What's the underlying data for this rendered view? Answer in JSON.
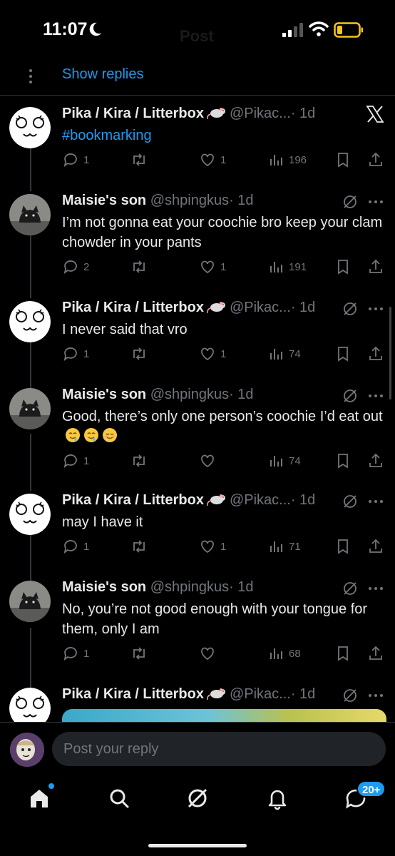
{
  "status_bar": {
    "time": "11:07"
  },
  "header": {
    "title_faint": "Post"
  },
  "show_replies": "Show replies",
  "tweets": [
    {
      "author": "Pika / Kira / Litterbox",
      "handle": "@Pikac...",
      "age": "· 1d",
      "text": "",
      "hashtag": "#bookmarking",
      "avatar": "white-cat-face",
      "stats": {
        "replies": "1",
        "retweets": "",
        "likes": "1",
        "views": "196"
      }
    },
    {
      "author": "Maisie's son",
      "handle": "@shpingkus",
      "age": "· 1d",
      "text": "I’m not gonna eat your coochie bro keep your clam chowder in your pants",
      "avatar": "grey-cat-photo",
      "stats": {
        "replies": "2",
        "retweets": "",
        "likes": "1",
        "views": "191"
      }
    },
    {
      "author": "Pika / Kira / Litterbox",
      "handle": "@Pikac...",
      "age": "· 1d",
      "text": "I never said that vro",
      "avatar": "white-cat-face",
      "stats": {
        "replies": "1",
        "retweets": "",
        "likes": "1",
        "views": "74"
      }
    },
    {
      "author": "Maisie's son",
      "handle": "@shpingkus",
      "age": "· 1d",
      "text": "Good, there’s only one person’s coochie I’d eat out",
      "avatar": "grey-cat-photo",
      "emoji_count": 3,
      "stats": {
        "replies": "1",
        "retweets": "",
        "likes": "",
        "views": "74"
      }
    },
    {
      "author": "Pika / Kira / Litterbox",
      "handle": "@Pikac...",
      "age": "· 1d",
      "text": "may I have it",
      "avatar": "white-cat-face",
      "stats": {
        "replies": "1",
        "retweets": "",
        "likes": "1",
        "views": "71"
      }
    },
    {
      "author": "Maisie's son",
      "handle": "@shpingkus",
      "age": "· 1d",
      "text": "No, you’re not good enough with your tongue for them, only I am",
      "avatar": "grey-cat-photo",
      "stats": {
        "replies": "1",
        "retweets": "",
        "likes": "",
        "views": "68"
      }
    },
    {
      "author": "Pika / Kira / Litterbox",
      "handle": "@Pikac...",
      "age": "· 1d",
      "text": "",
      "avatar": "white-cat-face"
    }
  ],
  "reply_bar": {
    "placeholder": "Post your reply"
  },
  "tab_bar": {
    "messages_badge": "20+"
  },
  "colors": {
    "accent": "#1d9bf0",
    "background": "#000000",
    "text": "#e7e9ea",
    "muted": "#71767b"
  }
}
